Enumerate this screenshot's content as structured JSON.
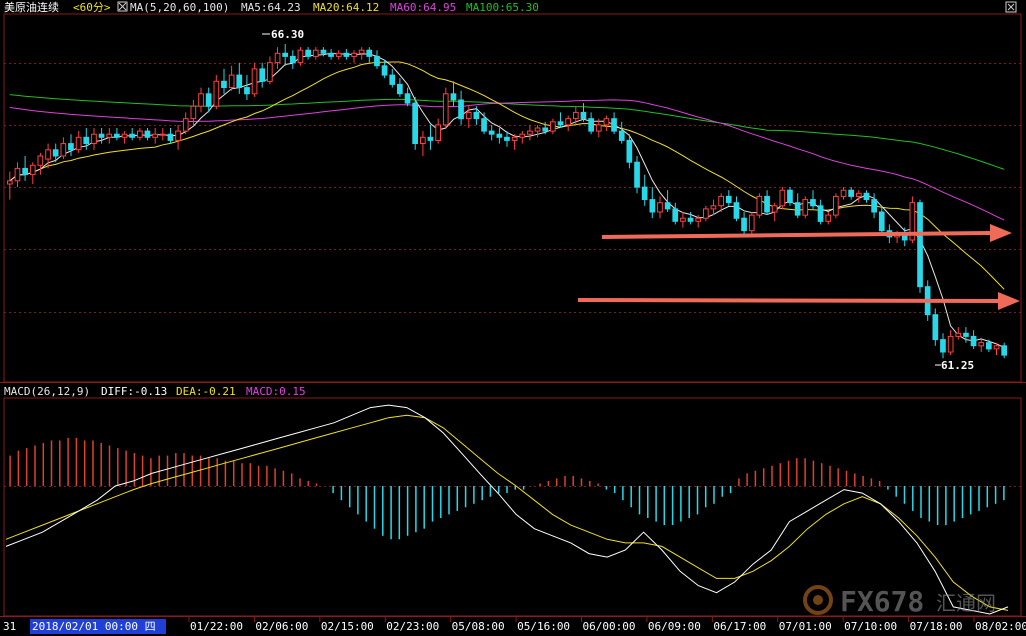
{
  "colors": {
    "background": "#000000",
    "frame": "#8b1a1a",
    "grid": "#7a1e1e",
    "up_candle": "#ff4040",
    "down_candle": "#28d8e8",
    "ma5": "#e6e6e6",
    "ma20": "#f0e020",
    "ma60": "#e040e0",
    "ma100": "#20c020",
    "diff": "#ffffff",
    "dea": "#f0e020",
    "macd_pos": "#e0402c",
    "macd_neg": "#28d8e8",
    "arrow": "#f06a5a",
    "axis_text": "#ffffff",
    "date_highlight_bg": "#1f3fd6"
  },
  "price_header": {
    "instrument": "美原油连续",
    "period": "<60分>",
    "ma_title": "MA(5,20,60,100)",
    "ma5": "MA5:64.23",
    "ma20": "MA20:64.12",
    "ma60": "MA60:64.95",
    "ma100": "MA100:65.30"
  },
  "macd_header": {
    "title": "MACD(26,12,9)",
    "diff": "DIFF:-0.13",
    "dea": "DEA:-0.21",
    "macd": "MACD:0.15"
  },
  "annotations": {
    "high_label": "66.30",
    "low_label": "61.25"
  },
  "x_axis": {
    "prefix": "31",
    "selected_date": "2018/02/01 00:00 四",
    "ticks": [
      "01/22:00",
      "02/06:00",
      "02/15:00",
      "02/23:00",
      "05/08:00",
      "05/16:00",
      "06/00:00",
      "06/09:00",
      "06/17:00",
      "07/01:00",
      "07/10:00",
      "07/18:00",
      "08/02:00"
    ]
  },
  "watermark": {
    "text": "FX678",
    "subtext": "汇通网"
  },
  "chart_data": [
    {
      "type": "candlestick",
      "title": "美原油连续 <60分>",
      "series": [
        {
          "name": "MA5",
          "value": 64.23
        },
        {
          "name": "MA20",
          "value": 64.12
        },
        {
          "name": "MA60",
          "value": 64.95
        },
        {
          "name": "MA100",
          "value": 65.3
        }
      ],
      "annotations": [
        {
          "label": "66.30",
          "kind": "high"
        },
        {
          "label": "61.25",
          "kind": "low"
        }
      ],
      "ylim": [
        60.9,
        66.75
      ],
      "candles": [
        [
          64.05,
          64.25,
          63.8,
          64.1
        ],
        [
          64.1,
          64.4,
          64.0,
          64.3
        ],
        [
          64.3,
          64.5,
          64.1,
          64.2
        ],
        [
          64.2,
          64.4,
          64.05,
          64.35
        ],
        [
          64.35,
          64.55,
          64.2,
          64.5
        ],
        [
          64.45,
          64.7,
          64.3,
          64.6
        ],
        [
          64.6,
          64.7,
          64.4,
          64.5
        ],
        [
          64.5,
          64.8,
          64.45,
          64.7
        ],
        [
          64.7,
          64.85,
          64.5,
          64.6
        ],
        [
          64.6,
          64.9,
          64.55,
          64.8
        ],
        [
          64.8,
          64.95,
          64.6,
          64.7
        ],
        [
          64.7,
          64.95,
          64.6,
          64.85
        ],
        [
          64.85,
          64.95,
          64.7,
          64.8
        ],
        [
          64.8,
          64.95,
          64.7,
          64.85
        ],
        [
          64.85,
          64.95,
          64.75,
          64.8
        ],
        [
          64.8,
          64.9,
          64.7,
          64.85
        ],
        [
          64.85,
          64.95,
          64.75,
          64.8
        ],
        [
          64.8,
          64.95,
          64.75,
          64.9
        ],
        [
          64.9,
          64.95,
          64.75,
          64.8
        ],
        [
          64.8,
          64.95,
          64.7,
          64.85
        ],
        [
          64.85,
          64.95,
          64.75,
          64.85
        ],
        [
          64.85,
          64.95,
          64.7,
          64.75
        ],
        [
          64.75,
          65.0,
          64.6,
          64.9
        ],
        [
          64.9,
          65.2,
          64.85,
          65.1
        ],
        [
          65.1,
          65.4,
          65.0,
          65.3
        ],
        [
          65.3,
          65.6,
          65.2,
          65.5
        ],
        [
          65.5,
          65.6,
          65.2,
          65.3
        ],
        [
          65.3,
          65.8,
          65.25,
          65.7
        ],
        [
          65.7,
          65.9,
          65.5,
          65.6
        ],
        [
          65.6,
          65.95,
          65.55,
          65.8
        ],
        [
          65.8,
          66.0,
          65.5,
          65.6
        ],
        [
          65.6,
          65.8,
          65.4,
          65.5
        ],
        [
          65.5,
          66.0,
          65.45,
          65.9
        ],
        [
          65.9,
          66.0,
          65.6,
          65.7
        ],
        [
          65.7,
          66.1,
          65.65,
          66.0
        ],
        [
          66.0,
          66.25,
          65.9,
          66.15
        ],
        [
          66.15,
          66.3,
          65.95,
          66.1
        ],
        [
          66.1,
          66.2,
          65.9,
          66.0
        ],
        [
          66.0,
          66.25,
          65.95,
          66.2
        ],
        [
          66.2,
          66.25,
          66.05,
          66.1
        ],
        [
          66.1,
          66.25,
          66.05,
          66.2
        ],
        [
          66.2,
          66.25,
          66.1,
          66.15
        ],
        [
          66.15,
          66.22,
          66.05,
          66.1
        ],
        [
          66.1,
          66.2,
          66.05,
          66.15
        ],
        [
          66.15,
          66.22,
          66.05,
          66.1
        ],
        [
          66.1,
          66.2,
          66.0,
          66.15
        ],
        [
          66.15,
          66.25,
          66.05,
          66.2
        ],
        [
          66.2,
          66.25,
          66.0,
          66.1
        ],
        [
          66.1,
          66.2,
          65.9,
          65.95
        ],
        [
          65.95,
          66.05,
          65.75,
          65.8
        ],
        [
          65.8,
          65.9,
          65.6,
          65.65
        ],
        [
          65.65,
          65.75,
          65.45,
          65.5
        ],
        [
          65.5,
          65.6,
          65.3,
          65.35
        ],
        [
          65.35,
          65.45,
          64.6,
          64.7
        ],
        [
          64.7,
          64.9,
          64.5,
          64.8
        ],
        [
          64.8,
          65.0,
          64.6,
          64.75
        ],
        [
          64.75,
          65.1,
          64.7,
          65.0
        ],
        [
          65.0,
          65.6,
          64.95,
          65.5
        ],
        [
          65.5,
          65.7,
          65.3,
          65.4
        ],
        [
          65.4,
          65.55,
          65.0,
          65.1
        ],
        [
          65.1,
          65.3,
          64.95,
          65.2
        ],
        [
          65.2,
          65.3,
          65.0,
          65.1
        ],
        [
          65.1,
          65.2,
          64.85,
          64.9
        ],
        [
          64.9,
          65.0,
          64.75,
          64.85
        ],
        [
          64.85,
          64.95,
          64.7,
          64.8
        ],
        [
          64.8,
          64.9,
          64.65,
          64.75
        ],
        [
          64.75,
          64.85,
          64.6,
          64.8
        ],
        [
          64.8,
          64.9,
          64.7,
          64.85
        ],
        [
          64.85,
          65.0,
          64.75,
          64.9
        ],
        [
          64.9,
          65.0,
          64.8,
          64.95
        ],
        [
          64.95,
          65.05,
          64.85,
          64.9
        ],
        [
          64.9,
          65.1,
          64.85,
          65.05
        ],
        [
          65.05,
          65.2,
          64.95,
          65.0
        ],
        [
          65.0,
          65.15,
          64.9,
          65.1
        ],
        [
          65.1,
          65.3,
          65.0,
          65.2
        ],
        [
          65.2,
          65.35,
          65.05,
          65.1
        ],
        [
          65.1,
          65.2,
          64.85,
          64.9
        ],
        [
          64.9,
          65.1,
          64.8,
          65.0
        ],
        [
          65.0,
          65.15,
          64.9,
          65.1
        ],
        [
          65.1,
          65.2,
          64.85,
          64.9
        ],
        [
          64.9,
          65.05,
          64.7,
          64.75
        ],
        [
          64.75,
          64.85,
          64.3,
          64.4
        ],
        [
          64.4,
          64.5,
          63.9,
          64.0
        ],
        [
          64.0,
          64.2,
          63.7,
          63.8
        ],
        [
          63.8,
          64.0,
          63.5,
          63.6
        ],
        [
          63.6,
          63.85,
          63.5,
          63.75
        ],
        [
          63.75,
          63.95,
          63.6,
          63.65
        ],
        [
          63.65,
          63.75,
          63.4,
          63.45
        ],
        [
          63.45,
          63.6,
          63.35,
          63.5
        ],
        [
          63.5,
          63.6,
          63.4,
          63.45
        ],
        [
          63.45,
          63.55,
          63.35,
          63.5
        ],
        [
          63.5,
          63.7,
          63.45,
          63.65
        ],
        [
          63.65,
          63.8,
          63.55,
          63.7
        ],
        [
          63.7,
          63.9,
          63.6,
          63.85
        ],
        [
          63.85,
          63.95,
          63.7,
          63.75
        ],
        [
          63.75,
          63.85,
          63.45,
          63.5
        ],
        [
          63.5,
          63.6,
          63.2,
          63.3
        ],
        [
          63.3,
          63.6,
          63.25,
          63.55
        ],
        [
          63.55,
          63.9,
          63.5,
          63.85
        ],
        [
          63.85,
          63.95,
          63.55,
          63.6
        ],
        [
          63.6,
          63.75,
          63.45,
          63.7
        ],
        [
          63.7,
          64.0,
          63.65,
          63.95
        ],
        [
          63.95,
          64.0,
          63.7,
          63.75
        ],
        [
          63.75,
          63.9,
          63.5,
          63.55
        ],
        [
          63.55,
          63.85,
          63.5,
          63.8
        ],
        [
          63.8,
          63.95,
          63.65,
          63.7
        ],
        [
          63.7,
          63.8,
          63.4,
          63.45
        ],
        [
          63.45,
          63.6,
          63.4,
          63.55
        ],
        [
          63.55,
          63.9,
          63.5,
          63.85
        ],
        [
          63.85,
          64.0,
          63.8,
          63.95
        ],
        [
          63.95,
          64.0,
          63.8,
          63.85
        ],
        [
          63.85,
          63.95,
          63.75,
          63.9
        ],
        [
          63.9,
          63.95,
          63.75,
          63.8
        ],
        [
          63.8,
          63.9,
          63.5,
          63.6
        ],
        [
          63.6,
          63.7,
          63.25,
          63.3
        ],
        [
          63.3,
          63.4,
          63.1,
          63.2
        ],
        [
          63.2,
          63.3,
          63.1,
          63.25
        ],
        [
          63.25,
          63.35,
          63.05,
          63.15
        ],
        [
          63.15,
          63.85,
          63.1,
          63.75
        ],
        [
          63.75,
          63.8,
          62.3,
          62.4
        ],
        [
          62.4,
          62.5,
          61.85,
          61.95
        ],
        [
          61.95,
          62.05,
          61.45,
          61.55
        ],
        [
          61.55,
          61.65,
          61.25,
          61.35
        ],
        [
          61.35,
          61.7,
          61.3,
          61.6
        ],
        [
          61.6,
          61.75,
          61.55,
          61.65
        ],
        [
          61.65,
          61.75,
          61.5,
          61.6
        ],
        [
          61.6,
          61.7,
          61.4,
          61.45
        ],
        [
          61.45,
          61.55,
          61.35,
          61.5
        ],
        [
          61.5,
          61.55,
          61.35,
          61.4
        ],
        [
          61.4,
          61.5,
          61.3,
          61.45
        ],
        [
          61.45,
          61.5,
          61.25,
          61.3
        ]
      ]
    },
    {
      "type": "bar",
      "title": "MACD(26,12,9)",
      "series": [
        {
          "name": "DIFF",
          "value": -0.13
        },
        {
          "name": "DEA",
          "value": -0.21
        },
        {
          "name": "MACD",
          "value": 0.15
        }
      ],
      "ylim": [
        -0.36,
        0.34
      ],
      "macd_hist": [
        0.12,
        0.14,
        0.15,
        0.16,
        0.17,
        0.18,
        0.18,
        0.19,
        0.19,
        0.18,
        0.18,
        0.17,
        0.16,
        0.15,
        0.14,
        0.13,
        0.12,
        0.11,
        0.12,
        0.12,
        0.13,
        0.13,
        0.12,
        0.12,
        0.11,
        0.11,
        0.1,
        0.1,
        0.09,
        0.09,
        0.08,
        0.08,
        0.07,
        0.06,
        0.05,
        0.03,
        0.02,
        0.01,
        0.0,
        -0.02,
        -0.04,
        -0.06,
        -0.08,
        -0.1,
        -0.12,
        -0.14,
        -0.15,
        -0.15,
        -0.14,
        -0.13,
        -0.12,
        -0.1,
        -0.09,
        -0.08,
        -0.07,
        -0.06,
        -0.05,
        -0.04,
        -0.03,
        -0.02,
        -0.02,
        -0.01,
        -0.01,
        0.0,
        0.01,
        0.02,
        0.03,
        0.04,
        0.04,
        0.03,
        0.02,
        0.01,
        -0.01,
        -0.02,
        -0.04,
        -0.06,
        -0.08,
        -0.09,
        -0.1,
        -0.11,
        -0.11,
        -0.1,
        -0.09,
        -0.08,
        -0.06,
        -0.05,
        -0.03,
        -0.02,
        0.03,
        0.05,
        0.06,
        0.07,
        0.08,
        0.09,
        0.1,
        0.11,
        0.11,
        0.1,
        0.09,
        0.08,
        0.07,
        0.06,
        0.05,
        0.04,
        0.03,
        0.02,
        -0.01,
        -0.03,
        -0.05,
        -0.07,
        -0.09,
        -0.1,
        -0.11,
        -0.11,
        -0.1,
        -0.09,
        -0.08,
        -0.07,
        -0.06,
        -0.05,
        -0.04
      ],
      "diff_line": [
        -0.17,
        -0.15,
        -0.13,
        -0.1,
        -0.07,
        -0.04,
        0.0,
        0.02,
        0.05,
        0.07,
        0.09,
        0.11,
        0.13,
        0.15,
        0.17,
        0.19,
        0.21,
        0.23,
        0.25,
        0.28,
        0.31,
        0.32,
        0.31,
        0.27,
        0.21,
        0.13,
        0.05,
        -0.02,
        -0.08,
        -0.12,
        -0.14,
        -0.16,
        -0.19,
        -0.2,
        -0.18,
        -0.13,
        -0.18,
        -0.24,
        -0.28,
        -0.3,
        -0.27,
        -0.22,
        -0.18,
        -0.1,
        -0.07,
        -0.04,
        -0.01,
        -0.02,
        -0.05,
        -0.1,
        -0.16,
        -0.24,
        -0.34,
        -0.35,
        -0.36,
        -0.34
      ],
      "dea_line": [
        -0.15,
        -0.13,
        -0.11,
        -0.09,
        -0.07,
        -0.05,
        -0.03,
        -0.01,
        0.01,
        0.03,
        0.05,
        0.07,
        0.09,
        0.11,
        0.13,
        0.15,
        0.17,
        0.19,
        0.21,
        0.23,
        0.25,
        0.27,
        0.28,
        0.27,
        0.23,
        0.17,
        0.11,
        0.05,
        0.0,
        -0.04,
        -0.08,
        -0.11,
        -0.13,
        -0.15,
        -0.16,
        -0.16,
        -0.17,
        -0.2,
        -0.23,
        -0.26,
        -0.26,
        -0.24,
        -0.21,
        -0.17,
        -0.12,
        -0.08,
        -0.05,
        -0.03,
        -0.05,
        -0.09,
        -0.14,
        -0.2,
        -0.27,
        -0.31,
        -0.34,
        -0.35
      ]
    }
  ]
}
